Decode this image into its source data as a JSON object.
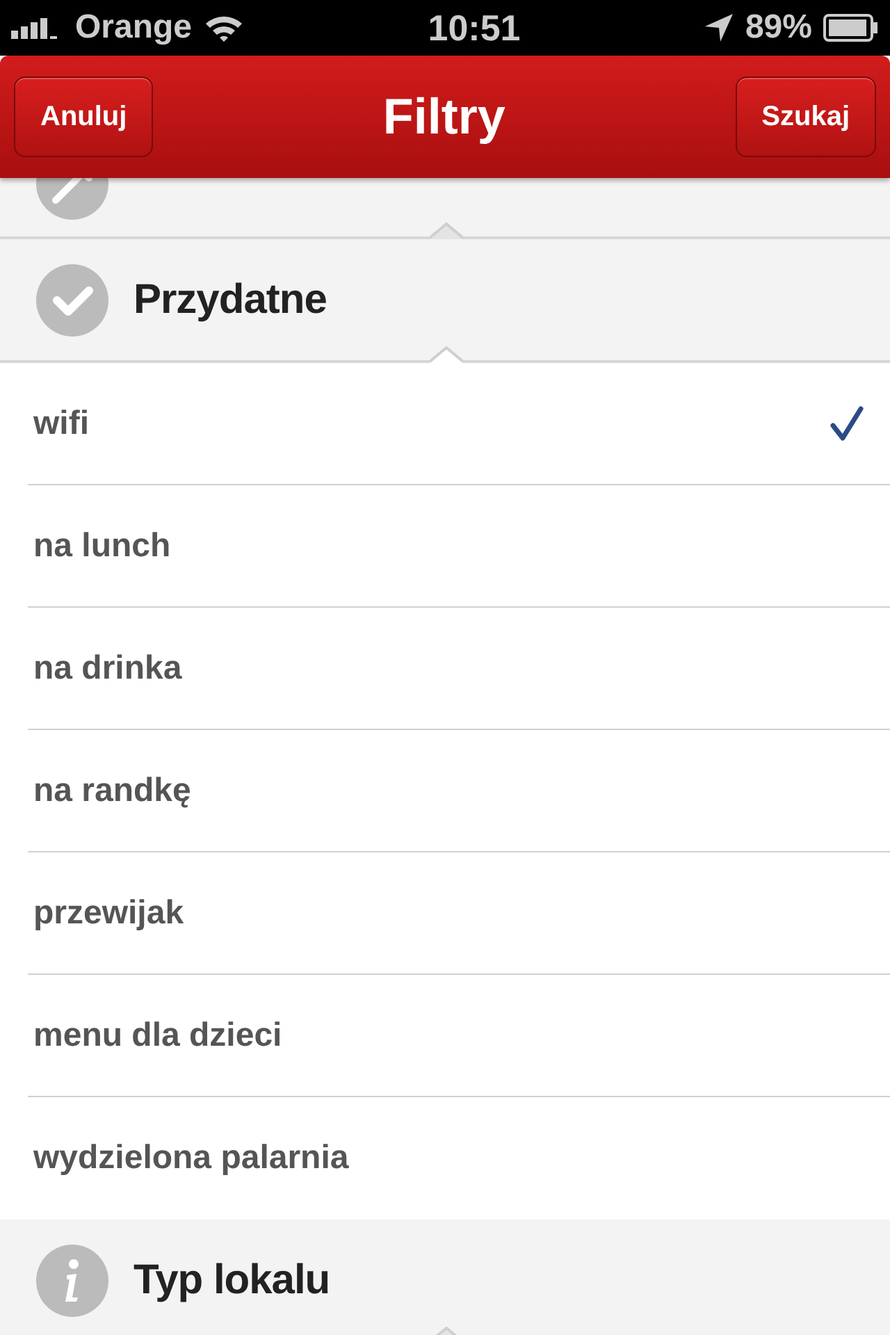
{
  "status_bar": {
    "carrier": "Orange",
    "time": "10:51",
    "battery": "89%"
  },
  "nav_bar": {
    "left_button": "Anuluj",
    "title": "Filtry",
    "right_button": "Szukaj"
  },
  "sections": [
    {
      "expanded": false
    },
    {
      "title": "Przydatne",
      "expanded": true,
      "items": [
        {
          "label": "wifi",
          "checked": true
        },
        {
          "label": "na lunch",
          "checked": false
        },
        {
          "label": "na drinka",
          "checked": false
        },
        {
          "label": "na randkę",
          "checked": false
        },
        {
          "label": "przewijak",
          "checked": false
        },
        {
          "label": "menu dla dzieci",
          "checked": false
        },
        {
          "label": "wydzielona palarnia",
          "checked": false
        }
      ]
    },
    {
      "title": "Typ lokalu",
      "expanded": false
    }
  ]
}
